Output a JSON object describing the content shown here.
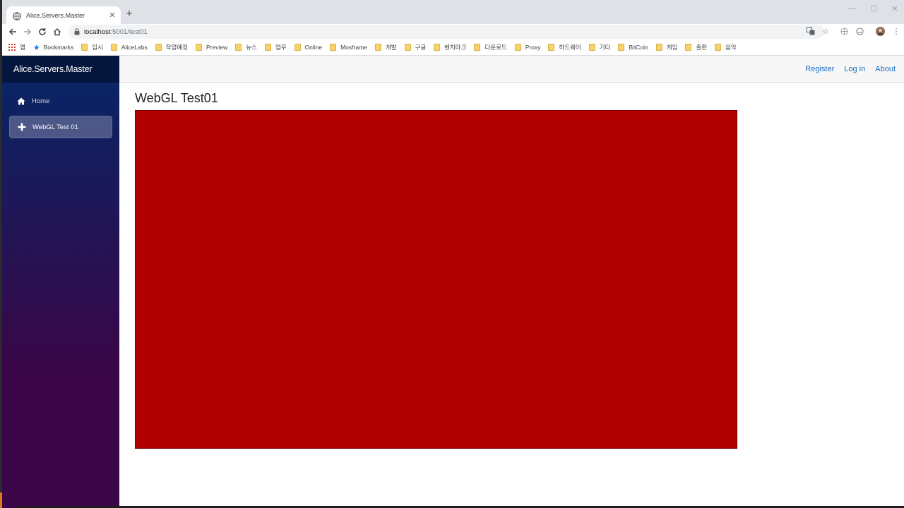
{
  "browser": {
    "tab_title": "Alice.Servers.Master",
    "url_host": "localhost",
    "url_path": ":5001/test01",
    "bookmarks": [
      {
        "label": "앱",
        "kind": "apps"
      },
      {
        "label": "Bookmarks",
        "kind": "star"
      },
      {
        "label": "임시",
        "kind": "folder"
      },
      {
        "label": "AliceLabs",
        "kind": "folder"
      },
      {
        "label": "작업예정",
        "kind": "folder"
      },
      {
        "label": "Preview",
        "kind": "folder"
      },
      {
        "label": "뉴스",
        "kind": "folder"
      },
      {
        "label": "업무",
        "kind": "folder"
      },
      {
        "label": "Online",
        "kind": "folder"
      },
      {
        "label": "Mosframe",
        "kind": "folder"
      },
      {
        "label": "개발",
        "kind": "folder"
      },
      {
        "label": "구글",
        "kind": "folder"
      },
      {
        "label": "벤치마크",
        "kind": "folder"
      },
      {
        "label": "다운로드",
        "kind": "folder"
      },
      {
        "label": "Proxy",
        "kind": "folder"
      },
      {
        "label": "하드웨어",
        "kind": "folder"
      },
      {
        "label": "기타",
        "kind": "folder"
      },
      {
        "label": "BitCoin",
        "kind": "folder"
      },
      {
        "label": "게임",
        "kind": "folder"
      },
      {
        "label": "출판",
        "kind": "folder"
      },
      {
        "label": "음악",
        "kind": "folder"
      }
    ]
  },
  "app": {
    "brand": "Alice.Servers.Master",
    "nav": [
      {
        "label": "Home",
        "icon": "home-icon",
        "active": false
      },
      {
        "label": "WebGL Test 01",
        "icon": "plus-icon",
        "active": true
      }
    ],
    "top_links": {
      "register": "Register",
      "login": "Log in",
      "about": "About"
    },
    "page_title": "WebGL Test01",
    "canvas_color": "#b00000"
  }
}
